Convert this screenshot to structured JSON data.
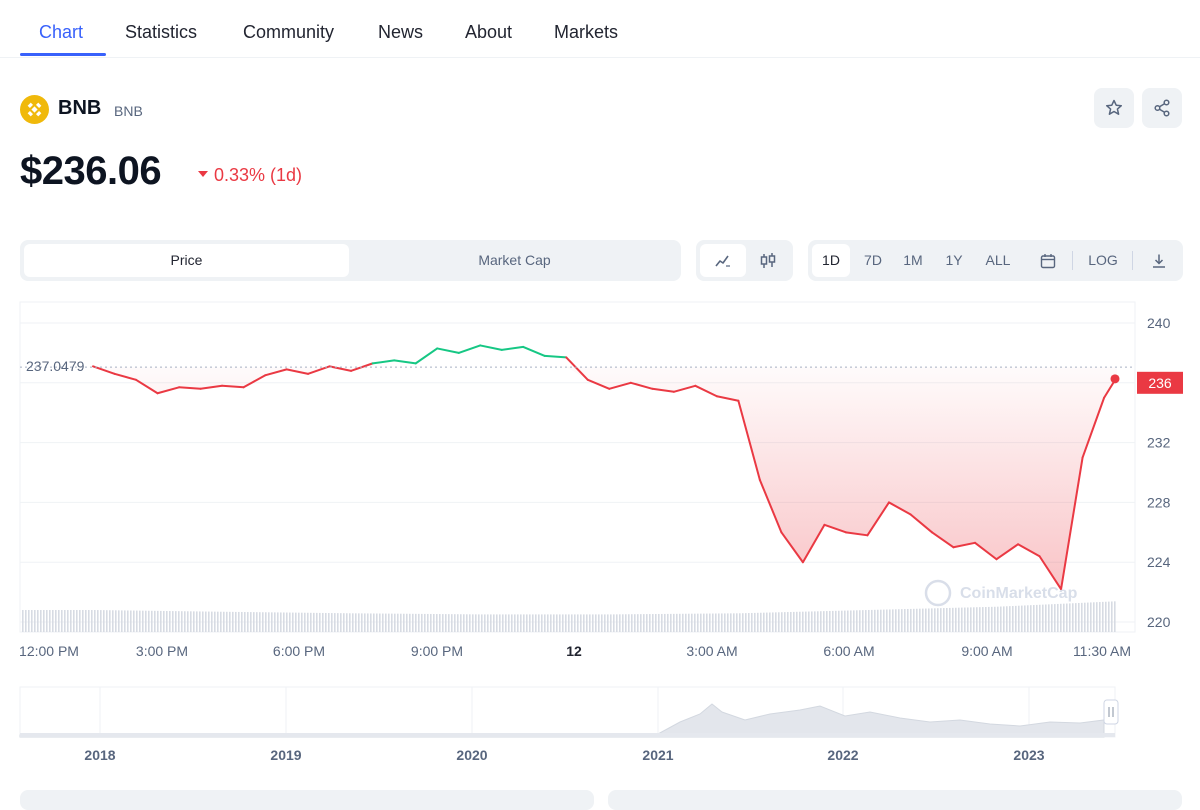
{
  "nav": {
    "tabs": [
      {
        "label": "Chart",
        "active": true
      },
      {
        "label": "Statistics"
      },
      {
        "label": "Community"
      },
      {
        "label": "News"
      },
      {
        "label": "About"
      },
      {
        "label": "Markets"
      }
    ]
  },
  "coin": {
    "name": "BNB",
    "symbol": "BNB",
    "price": "$236.06",
    "change": "0.33% (1d)",
    "change_direction": "down",
    "logo_icon": "bnb-logo-icon",
    "actions": [
      {
        "icon": "star-icon"
      },
      {
        "icon": "share-icon"
      }
    ]
  },
  "controls": {
    "metric_tabs": [
      {
        "label": "Price",
        "active": true
      },
      {
        "label": "Market Cap"
      }
    ],
    "chart_type_icons": [
      "line-chart-icon",
      "candlestick-icon"
    ],
    "ranges": [
      {
        "label": "1D",
        "active": true
      },
      {
        "label": "7D"
      },
      {
        "label": "1M"
      },
      {
        "label": "1Y"
      },
      {
        "label": "ALL"
      }
    ],
    "calendar_icon": "calendar-icon",
    "log_label": "LOG",
    "download_icon": "download-icon"
  },
  "colors": {
    "accent": "#3861fb",
    "up": "#16c784",
    "down": "#ea3943",
    "gold": "#f0b90b"
  },
  "watermark": "CoinMarketCap",
  "chart_data": {
    "type": "line",
    "x_tick_labels": [
      "12:00 PM",
      "3:00 PM",
      "6:00 PM",
      "9:00 PM",
      "12",
      "3:00 AM",
      "6:00 AM",
      "9:00 AM",
      "11:30 AM"
    ],
    "y_tick_labels": [
      "240",
      "236",
      "232",
      "228",
      "224",
      "220"
    ],
    "ylim": [
      216,
      241
    ],
    "reference_price": 237.0479,
    "reference_label": "237.0479",
    "current_price": 236,
    "current_label": "236",
    "series": [
      {
        "x": [
          0,
          0.5,
          1,
          1.5,
          2,
          2.5,
          3,
          3.5,
          4,
          4.5,
          5,
          5.5,
          6,
          6.5,
          7,
          7.5,
          8,
          8.5,
          9,
          9.5,
          10,
          10.5,
          11,
          11.5,
          12,
          12.5,
          13,
          13.5,
          14,
          14.5,
          15,
          15.5,
          16,
          16.5,
          17,
          17.5,
          18,
          18.5,
          19,
          19.5,
          20,
          20.5,
          21,
          21.5,
          22,
          22.5,
          23,
          23.5,
          23.8
        ],
        "values": [
          237.1,
          236.6,
          236.2,
          235.3,
          235.7,
          235.6,
          235.8,
          235.7,
          236.5,
          236.9,
          236.6,
          237.1,
          236.8,
          237.3,
          237.5,
          237.3,
          238.3,
          238.0,
          238.5,
          238.2,
          238.4,
          237.8,
          237.7,
          236.2,
          235.6,
          236.0,
          235.6,
          235.4,
          235.8,
          235.1,
          234.8,
          229.5,
          226.0,
          224.0,
          226.5,
          226.0,
          225.8,
          228.0,
          227.2,
          226.0,
          225.0,
          225.3,
          224.2,
          225.2,
          224.4,
          222.2,
          231.0,
          235.0,
          236.4
        ]
      }
    ],
    "volume": {
      "x": [
        0,
        3,
        6,
        9,
        12,
        15,
        18,
        21,
        23.8
      ],
      "values": [
        1.0,
        0.92,
        0.85,
        0.8,
        0.8,
        0.85,
        1.0,
        1.15,
        1.4
      ]
    },
    "navigator": {
      "x_tick_labels": [
        "2018",
        "2019",
        "2020",
        "2021",
        "2022",
        "2023"
      ]
    }
  }
}
